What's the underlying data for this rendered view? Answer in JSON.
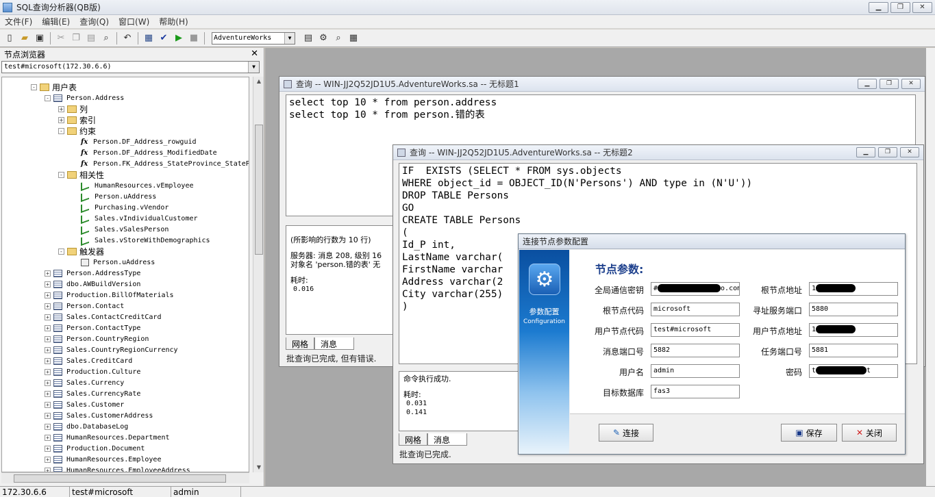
{
  "app": {
    "title": "SQL查询分析器(QB版)"
  },
  "menu": [
    "文件(F)",
    "编辑(E)",
    "查询(Q)",
    "窗口(W)",
    "帮助(H)"
  ],
  "toolbar": {
    "database": "AdventureWorks"
  },
  "node_browser": {
    "title": "节点浏览器",
    "connection": "test#microsoft(172.30.6.6)",
    "tree": [
      {
        "label": "用户表",
        "icon": "folder",
        "indent": 2,
        "exp": "-",
        "cn": true
      },
      {
        "label": "Person.Address",
        "icon": "table",
        "indent": 3,
        "exp": "-"
      },
      {
        "label": "列",
        "icon": "folder",
        "indent": 4,
        "exp": "+",
        "cn": true
      },
      {
        "label": "索引",
        "icon": "folder",
        "indent": 4,
        "exp": "+",
        "cn": true
      },
      {
        "label": "约束",
        "icon": "folder",
        "indent": 4,
        "exp": "-",
        "cn": true
      },
      {
        "label": "Person.DF_Address_rowguid",
        "icon": "fx",
        "indent": 5
      },
      {
        "label": "Person.DF_Address_ModifiedDate",
        "icon": "fx",
        "indent": 5
      },
      {
        "label": "Person.FK_Address_StateProvince_StateProvinceID",
        "icon": "fx",
        "indent": 5
      },
      {
        "label": "相关性",
        "icon": "folder",
        "indent": 4,
        "exp": "-",
        "cn": true
      },
      {
        "label": "HumanResources.vEmployee",
        "icon": "rel",
        "indent": 5
      },
      {
        "label": "Person.uAddress",
        "icon": "rel",
        "indent": 5
      },
      {
        "label": "Purchasing.vVendor",
        "icon": "rel",
        "indent": 5
      },
      {
        "label": "Sales.vIndividualCustomer",
        "icon": "rel",
        "indent": 5
      },
      {
        "label": "Sales.vSalesPerson",
        "icon": "rel",
        "indent": 5
      },
      {
        "label": "Sales.vStoreWithDemographics",
        "icon": "rel",
        "indent": 5
      },
      {
        "label": "触发器",
        "icon": "folder",
        "indent": 4,
        "exp": "-",
        "cn": true
      },
      {
        "label": "Person.uAddress",
        "icon": "trig",
        "indent": 5
      },
      {
        "label": "Person.AddressType",
        "icon": "table",
        "indent": 3,
        "exp": "+"
      },
      {
        "label": "dbo.AWBuildVersion",
        "icon": "table",
        "indent": 3,
        "exp": "+"
      },
      {
        "label": "Production.BillOfMaterials",
        "icon": "table",
        "indent": 3,
        "exp": "+"
      },
      {
        "label": "Person.Contact",
        "icon": "table",
        "indent": 3,
        "exp": "+"
      },
      {
        "label": "Sales.ContactCreditCard",
        "icon": "table",
        "indent": 3,
        "exp": "+"
      },
      {
        "label": "Person.ContactType",
        "icon": "table",
        "indent": 3,
        "exp": "+"
      },
      {
        "label": "Person.CountryRegion",
        "icon": "table",
        "indent": 3,
        "exp": "+"
      },
      {
        "label": "Sales.CountryRegionCurrency",
        "icon": "table",
        "indent": 3,
        "exp": "+"
      },
      {
        "label": "Sales.CreditCard",
        "icon": "table",
        "indent": 3,
        "exp": "+"
      },
      {
        "label": "Production.Culture",
        "icon": "table",
        "indent": 3,
        "exp": "+"
      },
      {
        "label": "Sales.Currency",
        "icon": "table",
        "indent": 3,
        "exp": "+"
      },
      {
        "label": "Sales.CurrencyRate",
        "icon": "table",
        "indent": 3,
        "exp": "+"
      },
      {
        "label": "Sales.Customer",
        "icon": "table",
        "indent": 3,
        "exp": "+"
      },
      {
        "label": "Sales.CustomerAddress",
        "icon": "table",
        "indent": 3,
        "exp": "+"
      },
      {
        "label": "dbo.DatabaseLog",
        "icon": "table",
        "indent": 3,
        "exp": "+"
      },
      {
        "label": "HumanResources.Department",
        "icon": "table",
        "indent": 3,
        "exp": "+"
      },
      {
        "label": "Production.Document",
        "icon": "table",
        "indent": 3,
        "exp": "+"
      },
      {
        "label": "HumanResources.Employee",
        "icon": "table",
        "indent": 3,
        "exp": "+"
      },
      {
        "label": "HumanResources.EmployeeAddress",
        "icon": "table",
        "indent": 3,
        "exp": "+"
      }
    ]
  },
  "query1": {
    "title": "查询 -- WIN-JJ2Q52JD1U5.AdventureWorks.sa -- 无标题1",
    "sql": "select top 10 * from person.address\nselect top 10 * from person.错的表",
    "result_line1": "(所影响的行数为 10 行)",
    "result_line2": "服务器: 消息 208, 级别 16",
    "result_line3": "对象名 'person.错的表' 无",
    "result_time_label": "耗时:",
    "result_time": "0.016",
    "tab_grid": "网格",
    "tab_msg": "消息",
    "status": "批查询已完成, 但有错误."
  },
  "query2": {
    "title": "查询 -- WIN-JJ2Q52JD1U5.AdventureWorks.sa -- 无标题2",
    "sql": "IF  EXISTS (SELECT * FROM sys.objects\nWHERE object_id = OBJECT_ID(N'Persons') AND type in (N'U'))\nDROP TABLE Persons\nGO\nCREATE TABLE Persons\n(\nId_P int,\nLastName varchar(\nFirstName varchar\nAddress varchar(2\nCity varchar(255)\n)",
    "result_line1": "命令执行成功.",
    "result_time_label": "耗时:",
    "result_time1": "0.031",
    "result_time2": "0.141",
    "tab_grid": "网格",
    "tab_msg": "消息",
    "status": "批查询已完成."
  },
  "dialog": {
    "title": "连接节点参数配置",
    "side_cn": "参数配置",
    "side_en": "Configuration",
    "heading": "节点参数:",
    "fields": {
      "comm_key_label": "全局通信密钥",
      "comm_key_value_prefix": "#",
      "comm_key_value_suffix": "o.com",
      "root_addr_label": "根节点地址",
      "root_addr_value_prefix": "1",
      "root_code_label": "根节点代码",
      "root_code_value": "microsoft",
      "addr_port_label": "寻址服务端口",
      "addr_port_value": "5880",
      "user_code_label": "用户节点代码",
      "user_code_value": "test#microsoft",
      "user_addr_label": "用户节点地址",
      "user_addr_value_prefix": "1",
      "msg_port_label": "消息端口号",
      "msg_port_value": "5882",
      "task_port_label": "任务端口号",
      "task_port_value": "5881",
      "user_label": "用户名",
      "user_value": "admin",
      "pwd_label": "密码",
      "pwd_value_prefix": "t",
      "pwd_value_suffix": "t",
      "target_db_label": "目标数据库",
      "target_db_value": "fas3"
    },
    "btn_connect": "连接",
    "btn_save": "保存",
    "btn_close": "关闭"
  },
  "statusbar": [
    "172.30.6.6",
    "test#microsoft",
    "admin"
  ]
}
